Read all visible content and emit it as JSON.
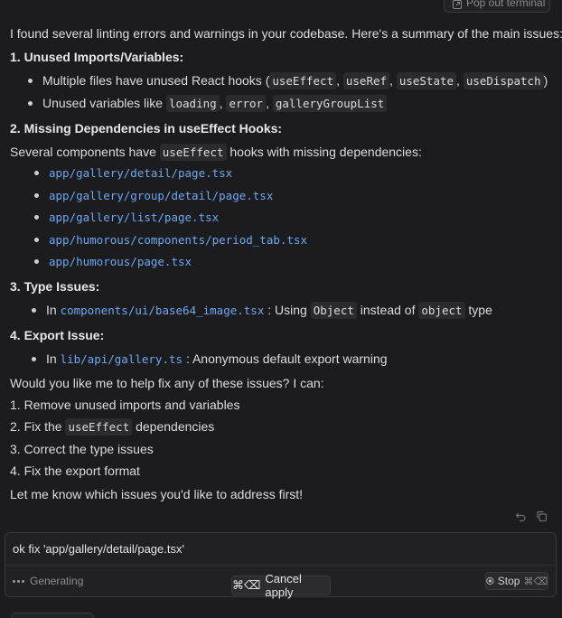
{
  "top_button": {
    "label": "Pop out terminal"
  },
  "message": {
    "intro": "I found several linting errors and warnings in your codebase. Here's a summary of the main issues:",
    "s1": {
      "title": "1. Unused Imports/Variables:",
      "b1_prefix": "Multiple files have unused React hooks (",
      "b1_codes": [
        "useEffect",
        "useRef",
        "useState",
        "useDispatch"
      ],
      "b1_suffix": ")",
      "b2_prefix": "Unused variables like",
      "b2_codes": [
        "loading",
        "error",
        "galleryGroupList"
      ]
    },
    "s2": {
      "title": "2. Missing Dependencies in useEffect Hooks:",
      "desc_prefix": "Several components have",
      "desc_code": "useEffect",
      "desc_suffix": "hooks with missing dependencies:",
      "files": [
        "app/gallery/detail/page.tsx",
        "app/gallery/group/detail/page.tsx",
        "app/gallery/list/page.tsx",
        "app/humorous/components/period_tab.tsx",
        "app/humorous/page.tsx"
      ]
    },
    "s3": {
      "title": "3. Type Issues:",
      "prefix": "In",
      "file": "components/ui/base64_image.tsx",
      "mid": ": Using",
      "code1": "Object",
      "mid2": "instead of",
      "code2": "object",
      "suffix": "type"
    },
    "s4": {
      "title": "4. Export Issue:",
      "prefix": "In",
      "file": "lib/api/gallery.ts",
      "suffix": ": Anonymous default export warning"
    },
    "question": "Would you like me to help fix any of these issues? I can:",
    "options": {
      "o1": "1. Remove unused imports and variables",
      "o2_prefix": "2. Fix the",
      "o2_code": "useEffect",
      "o2_suffix": "dependencies",
      "o3": "3. Correct the type issues",
      "o4": "4. Fix the export format"
    },
    "closing": "Let me know which issues you'd like to address first!"
  },
  "input": {
    "value": "ok fix 'app/gallery/detail/page.tsx'"
  },
  "status": {
    "generating": "Generating"
  },
  "cancel": {
    "shortcut": "⌘⌫",
    "label": "Cancel apply"
  },
  "stop": {
    "label": "Stop",
    "shortcut": "⌘⌫"
  },
  "icons": [
    "pop-out-icon",
    "undo-icon",
    "copy-icon",
    "stop-icon"
  ]
}
